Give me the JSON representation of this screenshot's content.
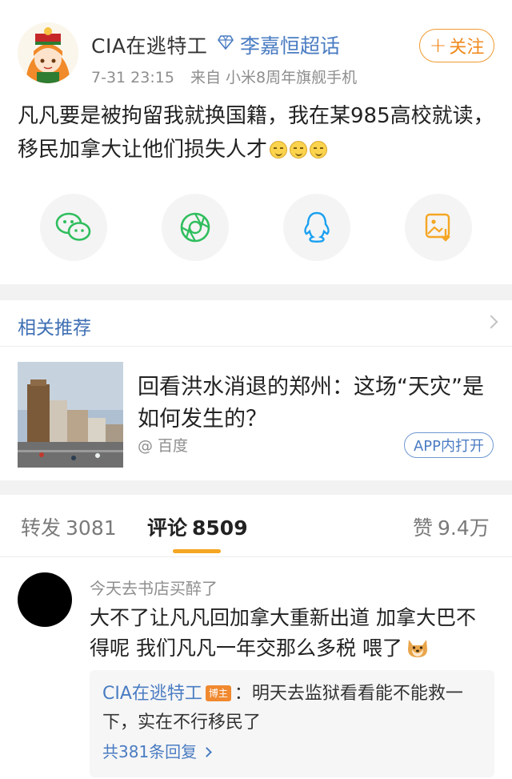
{
  "post": {
    "username": "CIA在逃特工",
    "topic": "李嘉恒超话",
    "time": "7-31 23:15",
    "source": "来自 小米8周年旗舰手机",
    "follow_label": "关注",
    "follow_plus": "+",
    "text": "凡凡要是被拘留我就换国籍，我在某985高校就读，移民加拿大让他们损失人才"
  },
  "share": {
    "items": [
      "wechat-icon",
      "moments-icon",
      "qq-icon",
      "save-image-icon"
    ],
    "colors": {
      "wechat": "#2fbe5d",
      "moments": "#2fbe5d",
      "qq": "#1aa0f0",
      "save": "#f5a623"
    }
  },
  "recommend": {
    "title": "相关推荐",
    "news_title": "回看洪水消退的郑州：这场“天灾”是如何发生的？",
    "news_source": "@ 百度",
    "app_button": "APP内打开"
  },
  "tabs": {
    "repost_label": "转发",
    "repost_count": "3081",
    "comment_label": "评论",
    "comment_count": "8509",
    "like_label": "赞",
    "like_count": "9.4万"
  },
  "comment": {
    "user": "今天去书店买醉了",
    "text": "大不了让凡凡回加拿大重新出道 加拿大巴不得呢 我们凡凡一年交那么多税 喂了",
    "reply_user": "CIA在逃特工",
    "reply_badge": "博主",
    "reply_text": "：明天去监狱看看能不能救一下，实在不行移民了",
    "reply_more": "共381条回复"
  },
  "colors": {
    "accent_orange": "#f5a623",
    "link_blue": "#4a7cc2"
  }
}
